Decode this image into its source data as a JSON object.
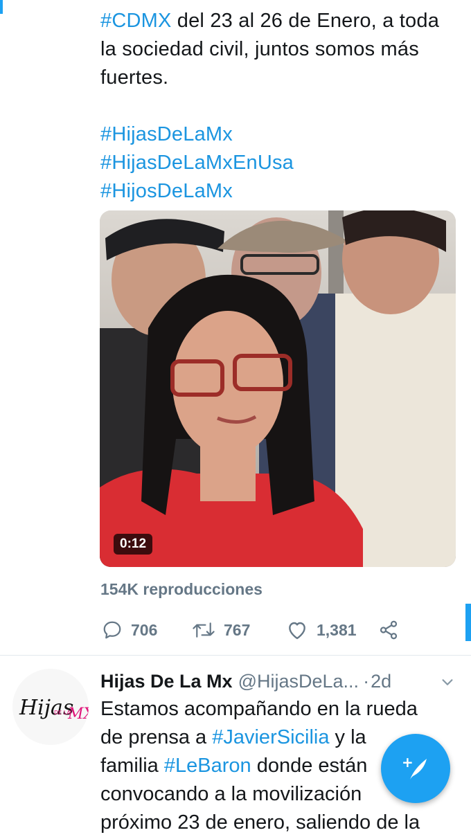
{
  "tweet1": {
    "lines": [
      {
        "tag": "#CDMX",
        "text": " del 23 al 26 de Enero, a toda"
      },
      {
        "tag": "",
        "text": "la sociedad civil, juntos somos más"
      },
      {
        "tag": "",
        "text": "fuertes."
      }
    ],
    "hashtags": [
      "#HijasDeLaMx",
      "#HijasDeLaMxEnUsa",
      "#HijosDeLaMx"
    ],
    "video": {
      "duration": "0:12"
    },
    "views": "154K reproducciones",
    "actions": {
      "reply": {
        "icon": "reply-icon",
        "count": "706"
      },
      "retweet": {
        "icon": "retweet-icon",
        "count": "767"
      },
      "like": {
        "icon": "heart-icon",
        "count": "1,381"
      },
      "share": {
        "icon": "share-icon"
      }
    }
  },
  "tweet2": {
    "avatar_text": "Hijas de la MX",
    "name": "Hijas De La Mx",
    "handle": "@HijasDeLa...",
    "separator": "·",
    "time": "2d",
    "lines": [
      [
        {
          "t": "Estamos acompañando en la rueda",
          "tag": false
        }
      ],
      [
        {
          "t": "de prensa a ",
          "tag": false
        },
        {
          "t": "#JavierSicilia",
          "tag": true
        },
        {
          "t": " y la",
          "tag": false
        }
      ],
      [
        {
          "t": "familia ",
          "tag": false
        },
        {
          "t": "#LeBaron",
          "tag": true
        },
        {
          "t": " donde están",
          "tag": false
        }
      ],
      [
        {
          "t": "convocando a la movilización",
          "tag": false
        }
      ],
      [
        {
          "t": "próximo 23 de enero, saliendo de la",
          "tag": false
        }
      ]
    ]
  },
  "fab": {
    "icon": "compose-tweet-icon",
    "plus": "+"
  },
  "colors": {
    "accent": "#1da1f2",
    "link": "#1b95e0",
    "muted": "#657786",
    "text": "#14171a",
    "brand_pink": "#e0147a"
  }
}
